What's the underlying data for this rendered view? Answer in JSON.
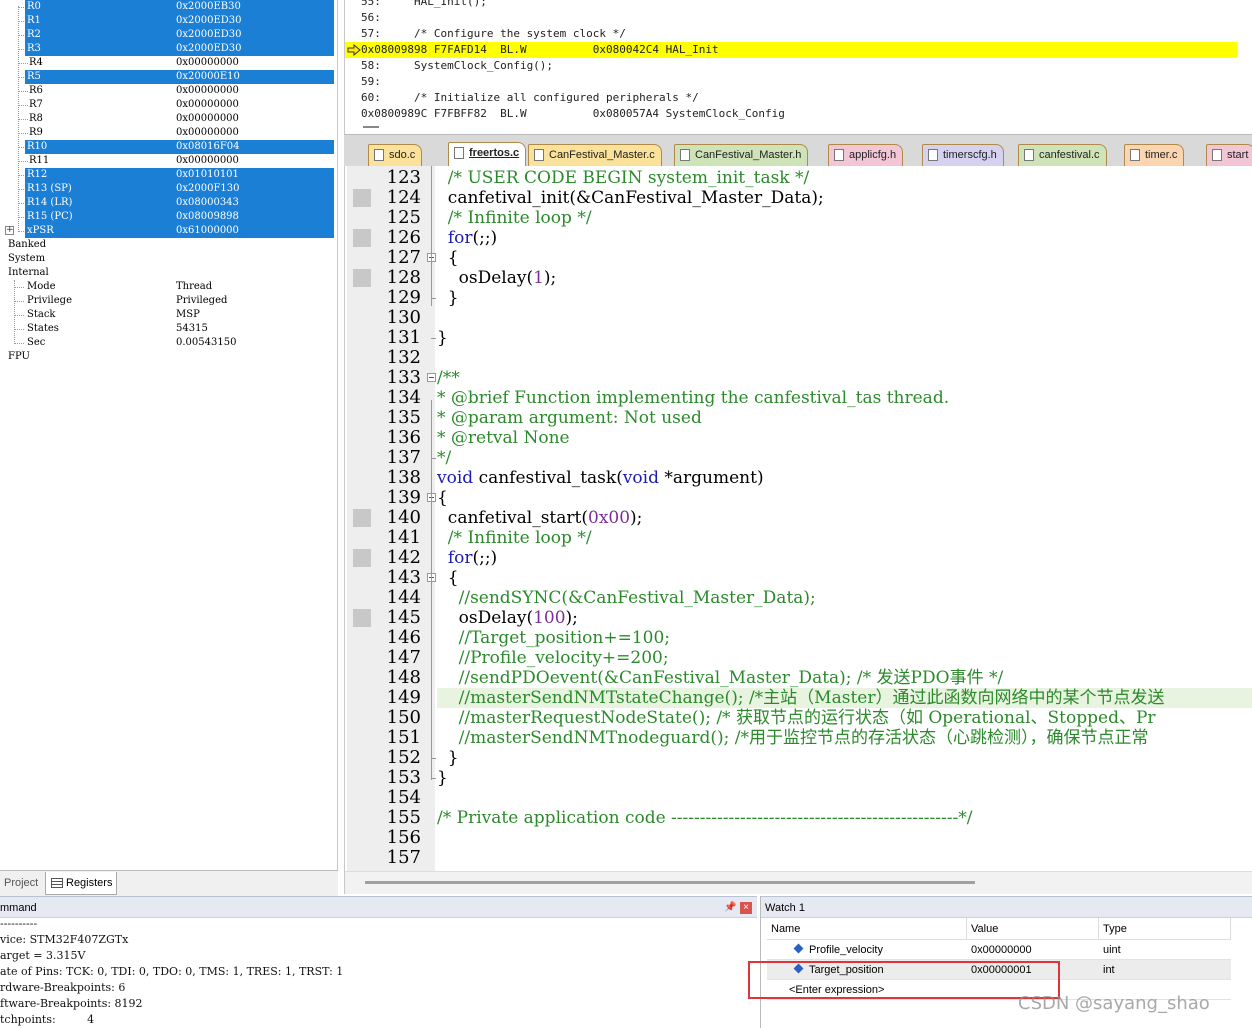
{
  "registers": [
    {
      "name": "R0",
      "value": "0x2000EB30",
      "selected": true
    },
    {
      "name": "R1",
      "value": "0x2000ED30",
      "selected": true
    },
    {
      "name": "R2",
      "value": "0x2000ED30",
      "selected": true
    },
    {
      "name": "R3",
      "value": "0x2000ED30",
      "selected": true
    },
    {
      "name": "R4",
      "value": "0x00000000",
      "selected": false
    },
    {
      "name": "R5",
      "value": "0x20000E10",
      "selected": true
    },
    {
      "name": "R6",
      "value": "0x00000000",
      "selected": false
    },
    {
      "name": "R7",
      "value": "0x00000000",
      "selected": false
    },
    {
      "name": "R8",
      "value": "0x00000000",
      "selected": false
    },
    {
      "name": "R9",
      "value": "0x00000000",
      "selected": false
    },
    {
      "name": "R10",
      "value": "0x08016F04",
      "selected": true
    },
    {
      "name": "R11",
      "value": "0x00000000",
      "selected": false
    },
    {
      "name": "R12",
      "value": "0x01010101",
      "selected": true
    },
    {
      "name": "R13 (SP)",
      "value": "0x2000F130",
      "selected": true
    },
    {
      "name": "R14 (LR)",
      "value": "0x08000343",
      "selected": true
    },
    {
      "name": "R15 (PC)",
      "value": "0x08009898",
      "selected": true
    },
    {
      "name": "xPSR",
      "value": "0x61000000",
      "selected": true
    }
  ],
  "register_groups": [
    "Banked",
    "System",
    "Internal"
  ],
  "internal": [
    {
      "name": "Mode",
      "value": "Thread"
    },
    {
      "name": "Privilege",
      "value": "Privileged"
    },
    {
      "name": "Stack",
      "value": "MSP"
    },
    {
      "name": "States",
      "value": "54315"
    },
    {
      "name": "Sec",
      "value": "0.00543150"
    }
  ],
  "fpu_label": "FPU",
  "panel_tabs": {
    "project": "Project",
    "registers": "Registers"
  },
  "disassembly": [
    {
      "text": "55:     HAL_Init();",
      "current": false
    },
    {
      "text": "56: ",
      "current": false
    },
    {
      "text": "57:     /* Configure the system clock */",
      "current": false
    },
    {
      "text": "0x08009898 F7FAFD14  BL.W          0x080042C4 HAL_Init",
      "current": true
    },
    {
      "text": "58:     SystemClock_Config();",
      "current": false
    },
    {
      "text": "59: ",
      "current": false
    },
    {
      "text": "60:     /* Initialize all configured peripherals */",
      "current": false
    },
    {
      "text": "0x0800989C F7FBFF82  BL.W          0x080057A4 SystemClock_Config",
      "current": false
    }
  ],
  "editor_tabs": [
    {
      "label": "sdo.c",
      "color": "yellow",
      "active": false
    },
    {
      "label": "freertos.c",
      "color": "white",
      "active": true
    },
    {
      "label": "CanFestival_Master.c",
      "color": "yellow",
      "active": false
    },
    {
      "label": "CanFestival_Master.h",
      "color": "green",
      "active": false
    },
    {
      "label": "applicfg.h",
      "color": "pink",
      "active": false
    },
    {
      "label": "timerscfg.h",
      "color": "lav",
      "active": false
    },
    {
      "label": "canfestival.c",
      "color": "green",
      "active": false
    },
    {
      "label": "timer.c",
      "color": "peach",
      "active": false
    },
    {
      "label": "start",
      "color": "pink",
      "active": false
    }
  ],
  "code_lines": [
    {
      "n": "123",
      "t": "  /* USER CODE BEGIN system_init_task */"
    },
    {
      "n": "124",
      "t": "  canfetival_init(&CanFestival_Master_Data);"
    },
    {
      "n": "125",
      "t": "  /* Infinite loop */"
    },
    {
      "n": "126",
      "t": "  for(;;)"
    },
    {
      "n": "127",
      "t": "  {"
    },
    {
      "n": "128",
      "t": "    osDelay(1);"
    },
    {
      "n": "129",
      "t": "  }"
    },
    {
      "n": "130",
      "t": ""
    },
    {
      "n": "131",
      "t": "}"
    },
    {
      "n": "132",
      "t": ""
    },
    {
      "n": "133",
      "t": "/**"
    },
    {
      "n": "134",
      "t": "* @brief Function implementing the canfestival_tas thread."
    },
    {
      "n": "135",
      "t": "* @param argument: Not used"
    },
    {
      "n": "136",
      "t": "* @retval None"
    },
    {
      "n": "137",
      "t": "*/"
    },
    {
      "n": "138",
      "t": "void canfestival_task(void *argument)"
    },
    {
      "n": "139",
      "t": "{"
    },
    {
      "n": "140",
      "t": "  canfetival_start(0x00);"
    },
    {
      "n": "141",
      "t": "  /* Infinite loop */"
    },
    {
      "n": "142",
      "t": "  for(;;)"
    },
    {
      "n": "143",
      "t": "  {"
    },
    {
      "n": "144",
      "t": "    //sendSYNC(&CanFestival_Master_Data);"
    },
    {
      "n": "145",
      "t": "    osDelay(100);"
    },
    {
      "n": "146",
      "t": "    //Target_position+=100;"
    },
    {
      "n": "147",
      "t": "    //Profile_velocity+=200;"
    },
    {
      "n": "148",
      "t": "    //sendPDOevent(&CanFestival_Master_Data); /* 发送PDO事件 */"
    },
    {
      "n": "149",
      "t": "    //masterSendNMTstateChange(); /*主站（Master）通过此函数向网络中的某个节点发送"
    },
    {
      "n": "150",
      "t": "    //masterRequestNodeState(); /* 获取节点的运行状态（如 Operational、Stopped、Pr"
    },
    {
      "n": "151",
      "t": "    //masterSendNMTnodeguard(); /*用于监控节点的存活状态（心跳检测），确保节点正常"
    },
    {
      "n": "152",
      "t": "  }"
    },
    {
      "n": "153",
      "t": "}"
    },
    {
      "n": "154",
      "t": ""
    },
    {
      "n": "155",
      "t": "/* Private application code --------------------------------------------------*/"
    },
    {
      "n": "156",
      "t": ""
    },
    {
      "n": "157",
      "t": ""
    }
  ],
  "command": {
    "title": "mmand",
    "lines": [
      "----------",
      "vice: STM32F407ZGTx",
      "arget = 3.315V",
      "ate of Pins: TCK: 0, TDI: 0, TDO: 0, TMS: 1, TRES: 1, TRST: 1",
      "rdware-Breakpoints: 6",
      "ftware-Breakpoints: 8192",
      "tchpoints:         4"
    ]
  },
  "watch": {
    "title": "Watch 1",
    "columns": [
      "Name",
      "Value",
      "Type"
    ],
    "rows": [
      {
        "name": "Profile_velocity",
        "value": "0x00000000",
        "type": "uint"
      },
      {
        "name": "Target_position",
        "value": "0x00000001",
        "type": "int"
      },
      {
        "name": "<Enter expression>",
        "value": "",
        "type": ""
      }
    ]
  },
  "watermark": "CSDN @sayang_shao",
  "colors": {
    "selection": "#1c7fd6",
    "current_line": "#ffff00",
    "comment": "#2b8a2b",
    "keyword": "#1a1ab8",
    "number": "#7b2e9a",
    "highlight_box": "#e0343b"
  }
}
